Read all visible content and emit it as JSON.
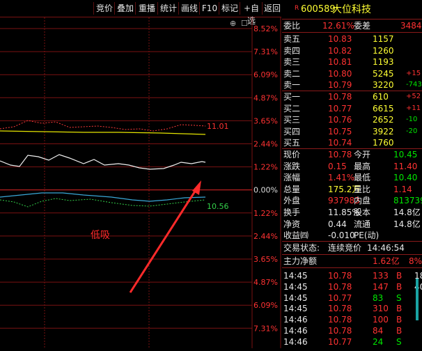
{
  "toolbar": {
    "buttons": [
      "竞价",
      "叠加",
      "重播",
      "统计",
      "画线",
      "F10",
      "标记",
      "+自选",
      "返回"
    ]
  },
  "chart": {
    "right_scale": [
      "8.52%",
      "7.31%",
      "6.09%",
      "4.87%",
      "3.65%",
      "2.44%",
      "1.22%",
      "0.00%",
      "1.22%",
      "2.44%",
      "3.65%",
      "4.87%",
      "6.09%",
      "7.31%"
    ],
    "price_label_high": "11.01",
    "price_label_low": "10.56",
    "annotation": "低吸",
    "top_icons": [
      "⊕",
      "☐"
    ],
    "colors": {
      "grid": "#7a1212",
      "zero_line": "#cc2222",
      "annotation": "#ff2a2a",
      "arrow": "#ff2a2a"
    }
  },
  "quote": {
    "market_tag": "R",
    "code": "600589",
    "name": "大位科技",
    "weibi_label": "委比",
    "weibi_value": "12.61%",
    "weicha_label": "委差",
    "weicha_value": "3484",
    "asks": [
      {
        "label": "卖五",
        "price": "10.83",
        "vol": "1157",
        "chg": ""
      },
      {
        "label": "卖四",
        "price": "10.82",
        "vol": "1260",
        "chg": ""
      },
      {
        "label": "卖三",
        "price": "10.81",
        "vol": "1193",
        "chg": ""
      },
      {
        "label": "卖二",
        "price": "10.80",
        "vol": "5245",
        "chg": "+15"
      },
      {
        "label": "卖一",
        "price": "10.79",
        "vol": "3220",
        "chg": "-743"
      }
    ],
    "bids": [
      {
        "label": "买一",
        "price": "10.78",
        "vol": "610",
        "chg": "+52"
      },
      {
        "label": "买二",
        "price": "10.77",
        "vol": "6615",
        "chg": "+11"
      },
      {
        "label": "买三",
        "price": "10.76",
        "vol": "2652",
        "chg": "-10"
      },
      {
        "label": "买四",
        "price": "10.75",
        "vol": "3922",
        "chg": "-20"
      },
      {
        "label": "买五",
        "price": "10.74",
        "vol": "1760",
        "chg": ""
      }
    ],
    "stats": [
      {
        "l1": "现价",
        "v1": "10.78",
        "c1": "r",
        "l2": "今开",
        "v2": "10.45",
        "c2": "g"
      },
      {
        "l1": "涨跌",
        "v1": "0.15",
        "c1": "r",
        "l2": "最高",
        "v2": "11.40",
        "c2": "r"
      },
      {
        "l1": "涨幅",
        "v1": "1.41%",
        "c1": "r",
        "l2": "最低",
        "v2": "10.40",
        "c2": "g"
      },
      {
        "l1": "总量",
        "v1": "175.2万",
        "c1": "y",
        "l2": "量比",
        "v2": "1.14",
        "c2": "r"
      },
      {
        "l1": "外盘",
        "v1": "937983",
        "c1": "r",
        "l2": "内盘",
        "v2": "813739",
        "c2": "g"
      },
      {
        "l1": "换手",
        "v1": "11.85%",
        "c1": "w",
        "l2": "股本",
        "v2": "14.8亿",
        "c2": "w"
      },
      {
        "l1": "净资",
        "v1": "0.44",
        "c1": "w",
        "l2": "流通",
        "v2": "14.8亿",
        "c2": "w"
      },
      {
        "l1": "收益㈣",
        "v1": "-0.010",
        "c1": "w",
        "l2": "PE(动)",
        "v2": "",
        "c2": "w"
      }
    ],
    "trade_status_label": "交易状态:",
    "trade_status_value": "连续竞价",
    "trade_status_time": "14:46:54",
    "main_net_label": "主力净额",
    "main_net_value": "1.62亿",
    "main_net_pct": "8%",
    "ticks": [
      {
        "time": "14:45",
        "price": "10.78",
        "vol": "133",
        "side": "B"
      },
      {
        "time": "14:45",
        "price": "10.78",
        "vol": "147",
        "side": "B"
      },
      {
        "time": "14:45",
        "price": "10.77",
        "vol": "83",
        "side": "S"
      },
      {
        "time": "14:45",
        "price": "10.78",
        "vol": "310",
        "side": "B"
      },
      {
        "time": "14:46",
        "price": "10.78",
        "vol": "100",
        "side": "B"
      },
      {
        "time": "14:46",
        "price": "10.78",
        "vol": "84",
        "side": "B"
      },
      {
        "time": "14:46",
        "price": "10.77",
        "vol": "24",
        "side": "S"
      }
    ],
    "tick_side_partial": [
      "18",
      "40",
      "",
      "",
      "",
      "",
      ""
    ]
  }
}
